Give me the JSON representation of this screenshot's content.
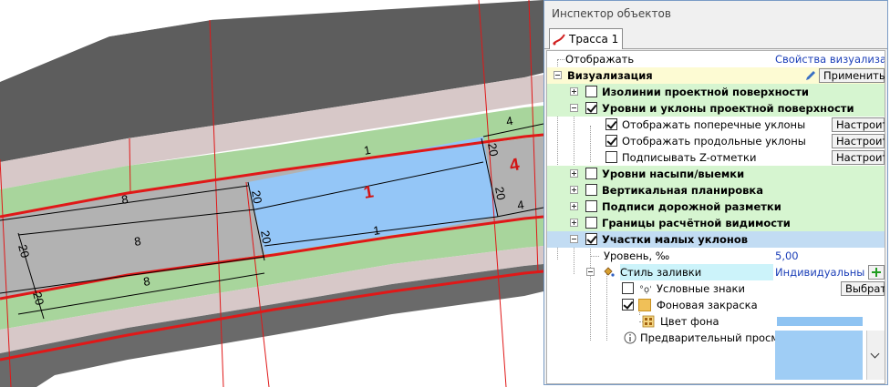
{
  "canvas": {
    "labels": {
      "w_8_upper": "8",
      "w_8_mid": "8",
      "w_8_lower": "8",
      "w_20_a": "20",
      "w_20_b": "20",
      "w_20_c": "20",
      "w_20_d": "20",
      "w_20_e": "20",
      "w_20_f": "20",
      "w_1_top": "1",
      "w_1_bottom": "1",
      "w_4_top": "4",
      "w_4_bottom": "4",
      "zone_1": "1",
      "zone_4": "4"
    },
    "colors": {
      "asphalt": "#5d5d5d",
      "lane_gray": "#b2b2b2",
      "green": "#a8d59c",
      "shoulder": "#d7c8c8",
      "highlight": "#94c6f7",
      "red_line": "#e01818"
    }
  },
  "inspector": {
    "title": "Инспектор объектов",
    "tab_label": "Трасса 1",
    "rows": {
      "display_label": "Отображать",
      "display_value": "Свойства визуализат...",
      "visualization_label": "Визуализация",
      "apply_button": "Применить...",
      "isolines": "Изолинии проектной поверхности",
      "levels_slopes": "Уровни и уклоны проектной поверхности",
      "show_cross": "Отображать поперечные уклоны",
      "show_long": "Отображать продольные уклоны",
      "sign_z": "Подписывать Z-отметки",
      "configure_label": "Настроить",
      "fill_levels": "Уровни насыпи/выемки",
      "vertical_plan": "Вертикальная планировка",
      "marking_labels": "Подписи дорожной разметки",
      "visibility": "Границы расчётной видимости",
      "low_slopes": "Участки малых уклонов",
      "level_label": "Уровень, ‰",
      "level_value": "5,00",
      "fill_style_label": "Стиль заливки",
      "fill_style_value": "Индивидуальный",
      "symbols": "Условные знаки",
      "choose_button": "Выбрать",
      "bg_fill": "Фоновая закраска",
      "bg_color": "Цвет фона",
      "preview": "Предварительный просмотр"
    },
    "checked": {
      "isolines": false,
      "levels_slopes": true,
      "show_cross": true,
      "show_long": true,
      "sign_z": false,
      "fill_levels": false,
      "vertical_plan": false,
      "marking_labels": false,
      "visibility": false,
      "low_slopes": true,
      "symbols": false,
      "bg_fill": true
    },
    "bg_color_value": "#8ec3f2"
  }
}
